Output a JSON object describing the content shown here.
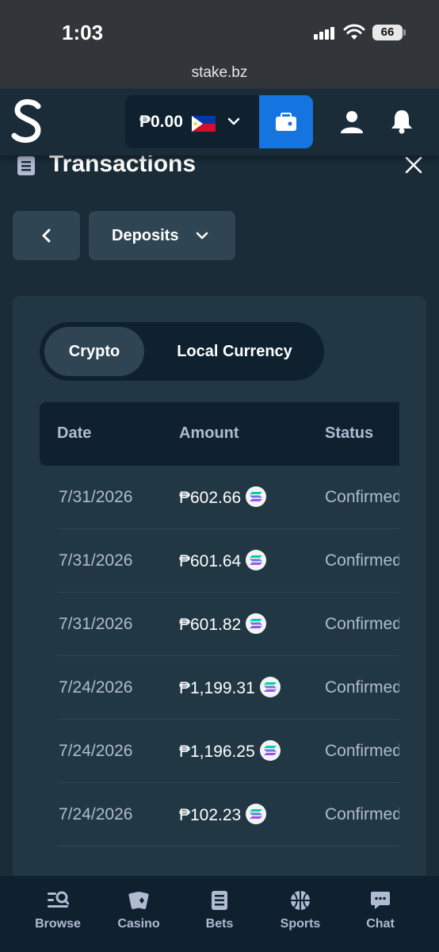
{
  "status_bar": {
    "time": "1:03",
    "battery": "66"
  },
  "browser": {
    "url": "stake.bz"
  },
  "header": {
    "balance": "₱0.00",
    "brand_color": "#1475e1",
    "icons": [
      "stake-logo-icon",
      "philippines-flag-icon",
      "chevron-down-icon",
      "wallet-icon",
      "user-icon",
      "bell-icon"
    ]
  },
  "page": {
    "title": "Transactions"
  },
  "filter": {
    "selected": "Deposits"
  },
  "toggle": {
    "options": [
      "Crypto",
      "Local Currency"
    ],
    "active": "Crypto"
  },
  "table": {
    "columns": [
      "Date",
      "Amount",
      "Status"
    ],
    "rows": [
      {
        "date": "7/31/2026",
        "amount": "₱602.66",
        "status": "Confirmed",
        "currency_icon": "solana-icon"
      },
      {
        "date": "7/31/2026",
        "amount": "₱601.64",
        "status": "Confirmed",
        "currency_icon": "solana-icon"
      },
      {
        "date": "7/31/2026",
        "amount": "₱601.82",
        "status": "Confirmed",
        "currency_icon": "solana-icon"
      },
      {
        "date": "7/24/2026",
        "amount": "₱1,199.31",
        "status": "Confirmed",
        "currency_icon": "solana-icon"
      },
      {
        "date": "7/24/2026",
        "amount": "₱1,196.25",
        "status": "Confirmed",
        "currency_icon": "solana-icon"
      },
      {
        "date": "7/24/2026",
        "amount": "₱102.23",
        "status": "Confirmed",
        "currency_icon": "solana-icon"
      }
    ]
  },
  "bottom_nav": {
    "items": [
      {
        "label": "Browse",
        "icon": "browse-icon"
      },
      {
        "label": "Casino",
        "icon": "cards-icon"
      },
      {
        "label": "Bets",
        "icon": "betslip-icon"
      },
      {
        "label": "Sports",
        "icon": "basketball-icon"
      },
      {
        "label": "Chat",
        "icon": "chat-icon"
      }
    ]
  }
}
